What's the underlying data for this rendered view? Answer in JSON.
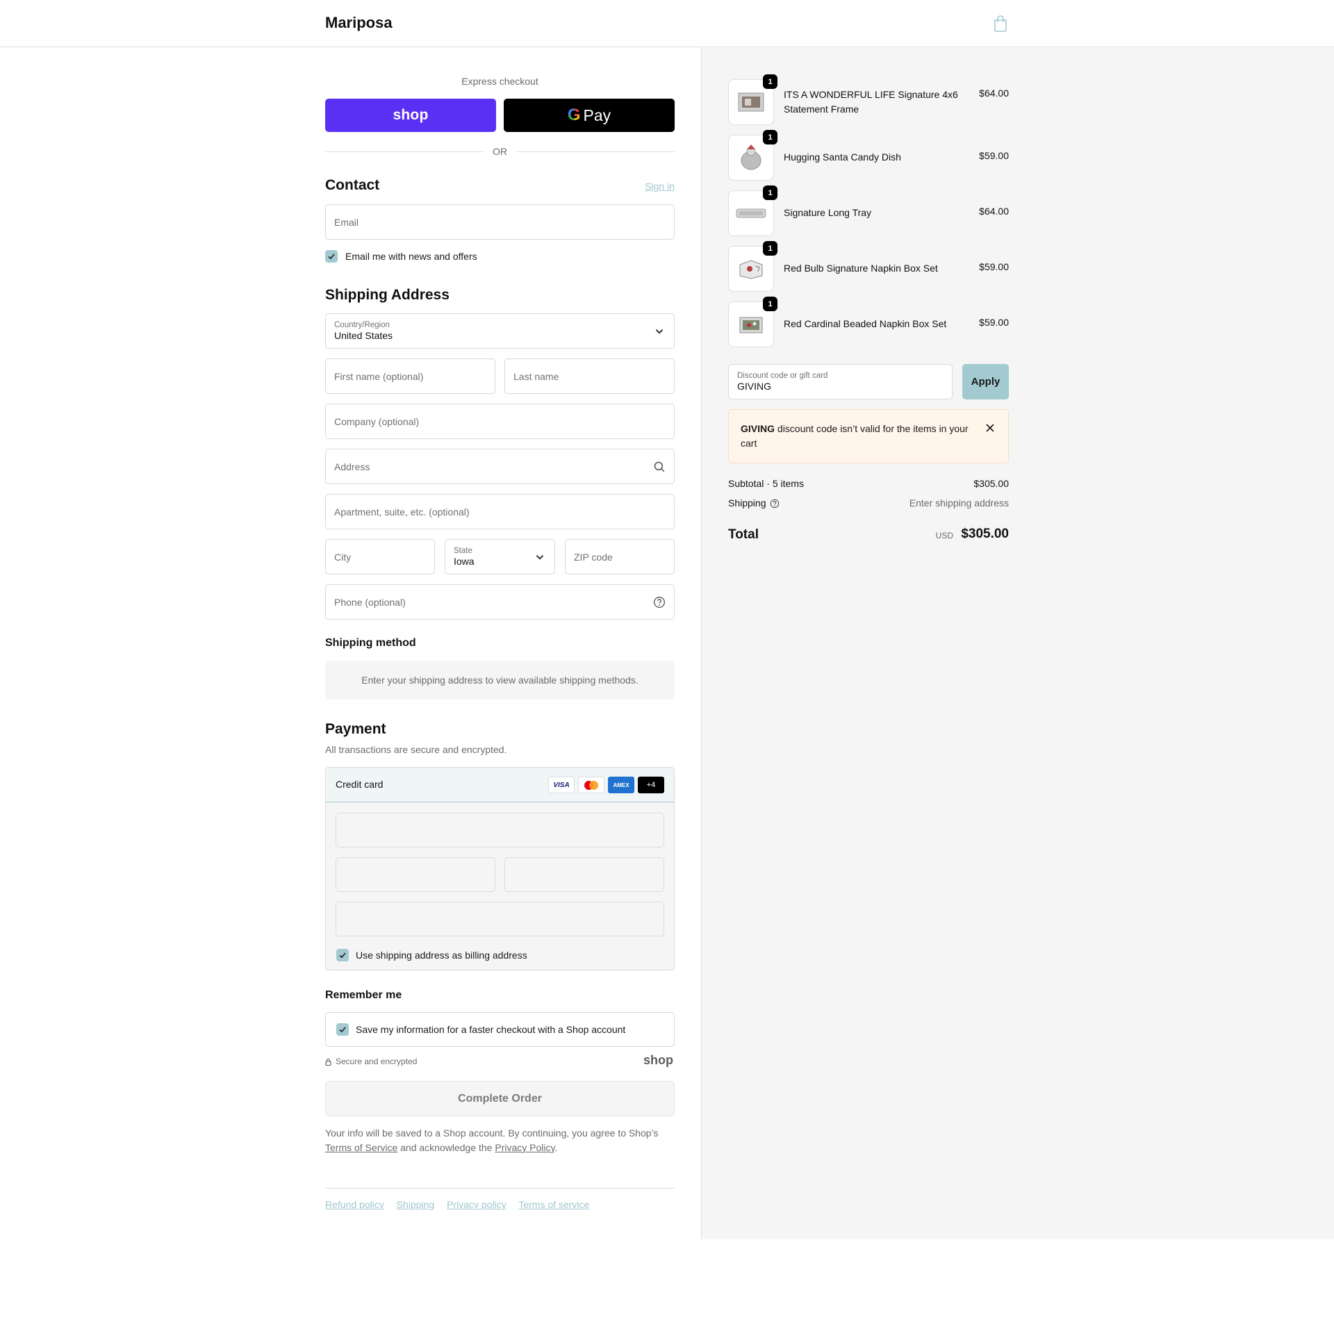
{
  "header": {
    "brand": "Mariposa",
    "cart_icon": "shopping-bag-icon"
  },
  "express": {
    "title": "Express checkout",
    "shop_label": "shop",
    "gpay_g": "G",
    "gpay_label": "Pay",
    "or_label": "OR"
  },
  "contact": {
    "heading": "Contact",
    "sign_in": "Sign in",
    "email_placeholder": "Email",
    "newsletter_label": "Email me with news and offers",
    "newsletter_checked": true
  },
  "shipping_address": {
    "heading": "Shipping Address",
    "country_label": "Country/Region",
    "country_value": "United States",
    "first_name_placeholder": "First name (optional)",
    "last_name_placeholder": "Last name",
    "company_placeholder": "Company (optional)",
    "address_placeholder": "Address",
    "apartment_placeholder": "Apartment, suite, etc. (optional)",
    "city_placeholder": "City",
    "state_label": "State",
    "state_value": "Iowa",
    "zip_placeholder": "ZIP code",
    "phone_placeholder": "Phone (optional)"
  },
  "shipping_method": {
    "heading": "Shipping method",
    "info": "Enter your shipping address to view available shipping methods."
  },
  "payment": {
    "heading": "Payment",
    "subtitle": "All transactions are secure and encrypted.",
    "method_label": "Credit card",
    "cards": [
      "VISA",
      "",
      "AMEX",
      "+4"
    ],
    "billing_label": "Use shipping address as billing address",
    "billing_checked": true
  },
  "remember": {
    "heading": "Remember me",
    "save_label": "Save my information for a faster checkout with a Shop account",
    "save_checked": true,
    "secure_label": "Secure and encrypted",
    "shop_logo": "shop"
  },
  "complete_button": "Complete Order",
  "legal": {
    "prefix": "Your info will be saved to a Shop account. By continuing, you agree to Shop’s",
    "terms": "Terms of Service",
    "middle": "and acknowledge the",
    "privacy": "Privacy Policy",
    "suffix": "."
  },
  "footer_links": [
    "Refund policy",
    "Shipping",
    "Privacy policy",
    "Terms of service"
  ],
  "order": {
    "items": [
      {
        "name": "ITS A WONDERFUL LIFE Signature 4x6 Statement Frame",
        "price": "$64.00",
        "qty": "1"
      },
      {
        "name": "Hugging Santa Candy Dish",
        "price": "$59.00",
        "qty": "1"
      },
      {
        "name": "Signature Long Tray",
        "price": "$64.00",
        "qty": "1"
      },
      {
        "name": "Red Bulb Signature Napkin Box Set",
        "price": "$59.00",
        "qty": "1"
      },
      {
        "name": "Red Cardinal Beaded Napkin Box Set",
        "price": "$59.00",
        "qty": "1"
      }
    ],
    "discount_label": "Discount code or gift card",
    "discount_value": "GIVING",
    "apply_label": "Apply",
    "notice_code": "GIVING",
    "notice_text": "discount code isn’t valid for the items in your cart",
    "subtotal_label": "Subtotal · 5 items",
    "subtotal_value": "$305.00",
    "shipping_label": "Shipping",
    "shipping_value": "Enter shipping address",
    "total_label": "Total",
    "currency": "USD",
    "total_value": "$305.00"
  },
  "colors": {
    "shop_purple": "#5a31f4",
    "accent": "#a3c9d1",
    "notice_bg": "#fff5ea",
    "summary_bg": "#f5f5f5"
  }
}
